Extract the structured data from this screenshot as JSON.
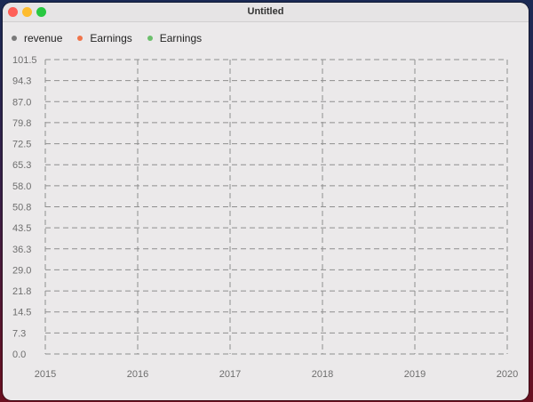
{
  "window": {
    "title": "Untitled"
  },
  "chart_data": {
    "type": "line",
    "title": "",
    "xlabel": "",
    "ylabel": "",
    "x": [
      "2015",
      "2016",
      "2017",
      "2018",
      "2019",
      "2020"
    ],
    "y_ticks": [
      "0.0",
      "7.3",
      "14.5",
      "21.8",
      "29.0",
      "36.3",
      "43.5",
      "50.8",
      "58.0",
      "65.3",
      "72.5",
      "79.8",
      "87.0",
      "94.3",
      "101.5"
    ],
    "ylim": [
      0,
      101.5
    ],
    "grid": true,
    "legend_position": "top-left",
    "series": [
      {
        "name": "revenue",
        "color": "#7a7a7a",
        "values": []
      },
      {
        "name": "Earnings",
        "color": "#f0744a",
        "values": []
      },
      {
        "name": "Earnings",
        "color": "#6cbf6c",
        "values": []
      }
    ]
  }
}
